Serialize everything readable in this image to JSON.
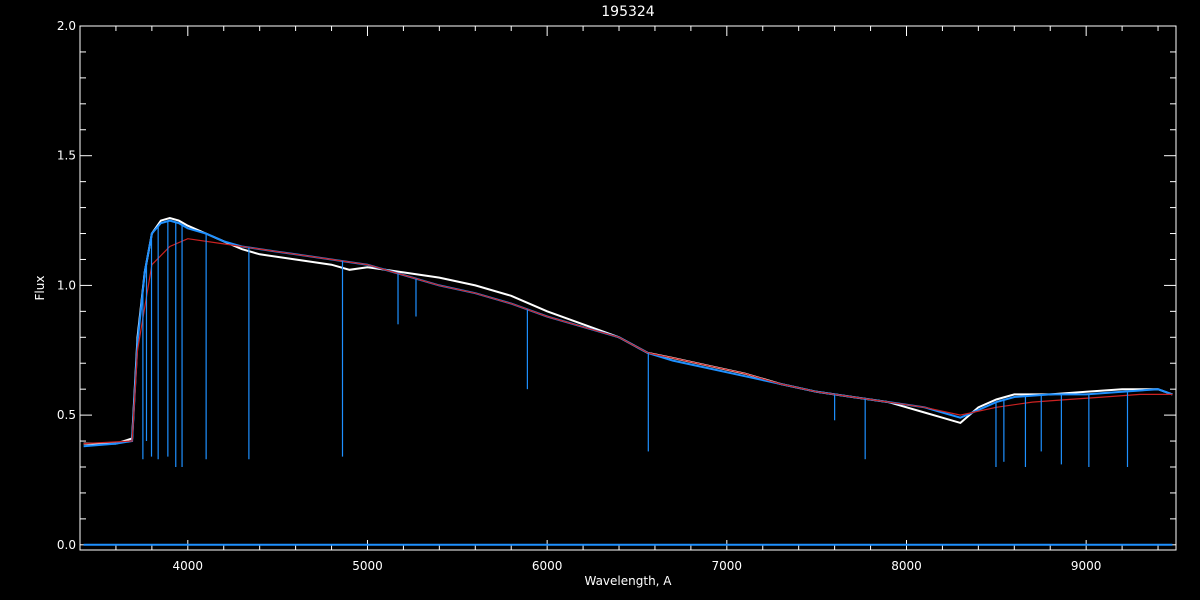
{
  "chart_data": {
    "type": "line",
    "title": "195324",
    "xlabel": "Wavelength, A",
    "ylabel": "Flux",
    "xlim": [
      3400,
      9500
    ],
    "ylim": [
      -0.02,
      2.0
    ],
    "x_ticks": [
      4000,
      5000,
      6000,
      7000,
      8000,
      9000
    ],
    "x_tick_labels": [
      "4000",
      "5000",
      "6000",
      "7000",
      "8000",
      "9000"
    ],
    "y_ticks": [
      0.0,
      0.5,
      1.0,
      1.5,
      2.0
    ],
    "y_tick_labels": [
      "0.0",
      "0.5",
      "1.0",
      "1.5",
      "2.0"
    ],
    "grid": false,
    "series": [
      {
        "color": "#ffffff",
        "x": [
          3420,
          3600,
          3690,
          3720,
          3760,
          3800,
          3850,
          3900,
          3950,
          4000,
          4100,
          4200,
          4300,
          4400,
          4500,
          4600,
          4700,
          4800,
          4900,
          5000,
          5200,
          5400,
          5600,
          5800,
          6000,
          6200,
          6400,
          6560,
          6700,
          6900,
          7100,
          7300,
          7500,
          7700,
          7900,
          8100,
          8200,
          8300,
          8400,
          8500,
          8600,
          8800,
          9000,
          9200,
          9400,
          9480
        ],
        "y": [
          0.39,
          0.39,
          0.41,
          0.8,
          1.05,
          1.2,
          1.25,
          1.26,
          1.25,
          1.23,
          1.2,
          1.17,
          1.14,
          1.12,
          1.11,
          1.1,
          1.09,
          1.08,
          1.06,
          1.07,
          1.05,
          1.03,
          1.0,
          0.96,
          0.9,
          0.85,
          0.8,
          0.74,
          0.72,
          0.69,
          0.66,
          0.62,
          0.59,
          0.57,
          0.55,
          0.51,
          0.49,
          0.47,
          0.53,
          0.56,
          0.58,
          0.58,
          0.59,
          0.6,
          0.6,
          0.58
        ]
      },
      {
        "color": "#1e90ff",
        "x": [
          3420,
          3600,
          3690,
          3720,
          3760,
          3800,
          3850,
          3900,
          3950,
          4000,
          4100,
          4200,
          4300,
          4400,
          4500,
          4600,
          4700,
          4800,
          4900,
          5000,
          5200,
          5400,
          5600,
          5800,
          6000,
          6200,
          6400,
          6560,
          6700,
          6900,
          7100,
          7300,
          7500,
          7700,
          7900,
          8100,
          8200,
          8300,
          8400,
          8500,
          8600,
          8800,
          9000,
          9200,
          9400,
          9480
        ],
        "y": [
          0.38,
          0.39,
          0.4,
          0.78,
          1.05,
          1.2,
          1.24,
          1.25,
          1.24,
          1.22,
          1.2,
          1.17,
          1.15,
          1.14,
          1.13,
          1.12,
          1.11,
          1.1,
          1.09,
          1.08,
          1.04,
          1.0,
          0.97,
          0.93,
          0.88,
          0.84,
          0.8,
          0.74,
          0.71,
          0.68,
          0.65,
          0.62,
          0.59,
          0.57,
          0.55,
          0.53,
          0.51,
          0.49,
          0.52,
          0.55,
          0.57,
          0.58,
          0.58,
          0.59,
          0.6,
          0.58
        ]
      },
      {
        "color": "#cc2222",
        "x": [
          3420,
          3690,
          3720,
          3800,
          3900,
          4000,
          4200,
          4400,
          4600,
          4800,
          5000,
          5200,
          5400,
          5600,
          5800,
          6000,
          6200,
          6400,
          6560,
          6700,
          6900,
          7100,
          7300,
          7500,
          7700,
          7900,
          8100,
          8300,
          8500,
          8700,
          8900,
          9100,
          9300,
          9480
        ],
        "y": [
          0.39,
          0.4,
          0.75,
          1.08,
          1.15,
          1.18,
          1.16,
          1.14,
          1.12,
          1.1,
          1.08,
          1.04,
          1.0,
          0.97,
          0.93,
          0.88,
          0.84,
          0.8,
          0.74,
          0.72,
          0.69,
          0.66,
          0.62,
          0.59,
          0.57,
          0.55,
          0.53,
          0.5,
          0.53,
          0.55,
          0.56,
          0.57,
          0.58,
          0.58
        ]
      },
      {
        "color": "#1e90ff",
        "x": [
          3420,
          9480
        ],
        "y": [
          0.0,
          0.0
        ]
      }
    ],
    "absorption_lines": [
      {
        "x": 3750,
        "y": 0.33
      },
      {
        "x": 3770,
        "y": 0.4
      },
      {
        "x": 3798,
        "y": 0.34
      },
      {
        "x": 3835,
        "y": 0.33
      },
      {
        "x": 3889,
        "y": 0.34
      },
      {
        "x": 3933,
        "y": 0.3
      },
      {
        "x": 3968,
        "y": 0.3
      },
      {
        "x": 4102,
        "y": 0.33
      },
      {
        "x": 4340,
        "y": 0.33
      },
      {
        "x": 4861,
        "y": 0.34
      },
      {
        "x": 5170,
        "y": 0.85
      },
      {
        "x": 5270,
        "y": 0.88
      },
      {
        "x": 5890,
        "y": 0.6
      },
      {
        "x": 6563,
        "y": 0.36
      },
      {
        "x": 7600,
        "y": 0.48
      },
      {
        "x": 7770,
        "y": 0.33
      },
      {
        "x": 8498,
        "y": 0.3
      },
      {
        "x": 8542,
        "y": 0.32
      },
      {
        "x": 8662,
        "y": 0.3
      },
      {
        "x": 8750,
        "y": 0.36
      },
      {
        "x": 8862,
        "y": 0.31
      },
      {
        "x": 9015,
        "y": 0.3
      },
      {
        "x": 9230,
        "y": 0.3
      },
      {
        "x": 9400,
        "y": 0.6
      }
    ]
  }
}
